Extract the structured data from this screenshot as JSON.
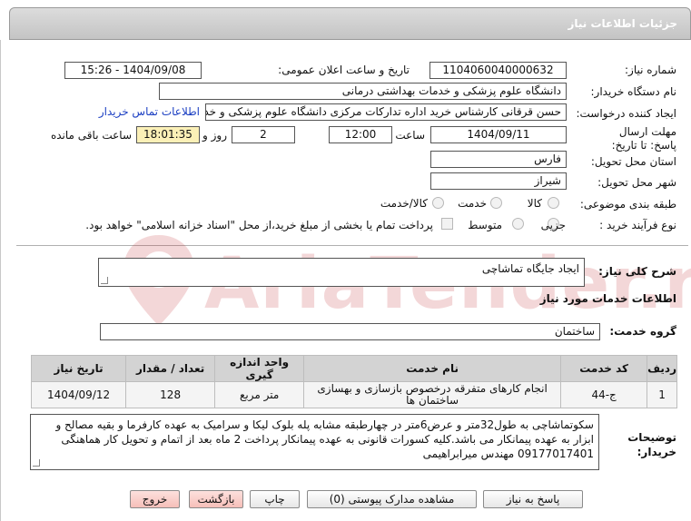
{
  "header": {
    "title": "جزئیات اطلاعات نیاز"
  },
  "fields": {
    "need_number_label": "شماره نیاز:",
    "need_number": "1104060040000632",
    "announce_label": "تاریخ و ساعت اعلان عمومی:",
    "announce_value": "1404/09/08 - 15:26",
    "buyer_org_label": "نام دستگاه خریدار:",
    "buyer_org": "دانشگاه علوم پزشکی و خدمات بهداشتی درمانی",
    "creator_label": "ایجاد کننده درخواست:",
    "creator": "حسن قرقانی کارشناس خرید اداره تدارکات مرکزی دانشگاه علوم پزشکی و خدم",
    "contact_link": "اطلاعات تماس خریدار",
    "deadline_label": "مهلت ارسال پاسخ: تا تاریخ:",
    "deadline_date": "1404/09/11",
    "time_label": "ساعت",
    "deadline_time": "12:00",
    "days_value": "2",
    "days_label": "روز و",
    "remaining_time": "18:01:35",
    "remaining_label": "ساعت باقی مانده",
    "province_label": "استان محل تحویل:",
    "province": "فارس",
    "city_label": "شهر محل تحویل:",
    "city": "شیراز",
    "category_label": "طبقه بندی موضوعی:",
    "category_options": [
      "کالا",
      "خدمت",
      "کالا/خدمت"
    ],
    "process_label": "نوع فرآیند خرید :",
    "process_options": [
      "جزیی",
      "متوسط"
    ],
    "payment_note": "پرداخت تمام یا بخشی از مبلغ خرید،از محل \"اسناد خزانه اسلامی\" خواهد بود."
  },
  "summary": {
    "label": "شرح کلی نیاز:",
    "value": "ایجاد جایگاه تماشاچی"
  },
  "services_section": {
    "title": "اطلاعات خدمات مورد نیاز",
    "group_label": "گروه خدمت:",
    "group_value": "ساختمان"
  },
  "table": {
    "headers": [
      "ردیف",
      "کد خدمت",
      "نام خدمت",
      "واحد اندازه گیری",
      "تعداد / مقدار",
      "تاریخ نیاز"
    ],
    "rows": [
      [
        "1",
        "ج-44",
        "انجام کارهای متفرقه درخصوص بازسازی و بهسازی ساختمان ها",
        "متر مربع",
        "128",
        "1404/09/12"
      ]
    ]
  },
  "buyer_notes": {
    "label": "توضیحات خریدار:",
    "value": "سکوتماشاچی به طول32متر و عرض6متر در چهارطبقه مشابه پله بلوک لیکا و سرامیک به عهده کارفرما و بقیه مصالح و ابزار به عهده پیمانکار می باشد.کلیه کسورات قانونی به عهده پیمانکار پرداخت 2 ماه بعد از اتمام و تحویل کار  هماهنگی 09177017401 مهندس میرابراهیمی"
  },
  "buttons": {
    "reply": "پاسخ به نیاز",
    "attachments": "مشاهده مدارک پیوستی (0)",
    "print": "چاپ",
    "back": "بازگشت",
    "exit": "خروج"
  },
  "watermark": {
    "text": "AriaTender.net"
  },
  "colors": {
    "link": "#1a3ec2",
    "highlight": "#fbf0b7",
    "exit_button": "#f6bfb9",
    "header": "#c4c4c4"
  }
}
